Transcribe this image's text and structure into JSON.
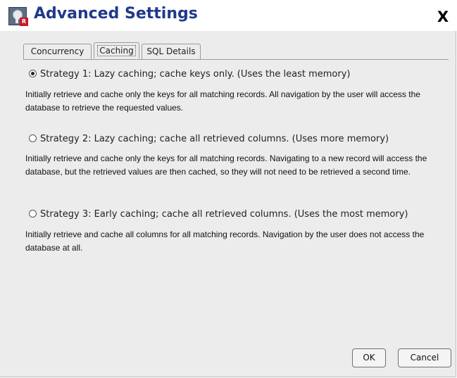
{
  "window": {
    "title": "Advanced Settings",
    "close_label": "X",
    "icon": "key-security-icon"
  },
  "tabs": [
    {
      "label": "Concurrency",
      "active": false
    },
    {
      "label": "Caching",
      "active": true
    },
    {
      "label": "SQL Details",
      "active": false
    }
  ],
  "options": [
    {
      "label": "Strategy 1: Lazy caching; cache keys only. (Uses the least memory)",
      "selected": true,
      "description": "Initially retrieve and cache only the keys for all matching records. All navigation by the user will access the database to retrieve the requested values."
    },
    {
      "label": "Strategy 2: Lazy caching; cache all retrieved columns. (Uses more memory)",
      "selected": false,
      "description": "Initially retrieve and cache only the keys for all matching records. Navigating to a new record will access the database, but the retrieved values are then cached, so they will not need to be retrieved a second time."
    },
    {
      "label": "Strategy 3: Early caching; cache all retrieved columns. (Uses the most memory)",
      "selected": false,
      "description": "Initially retrieve and cache all columns for all matching records. Navigation by the user does not access the database at all."
    }
  ],
  "buttons": {
    "ok_label": "OK",
    "cancel_label": "Cancel"
  },
  "colors": {
    "title_text": "#1f3a8a",
    "dialog_background": "#ececec"
  }
}
